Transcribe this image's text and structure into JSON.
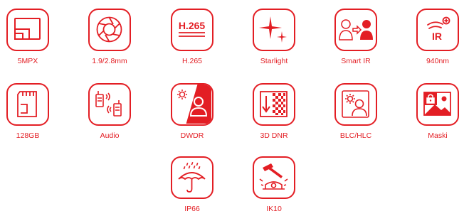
{
  "accent_color": "#e31e24",
  "features": [
    {
      "label": "5MPX",
      "icon": "resolution-screen-icon"
    },
    {
      "label": "1.9/2.8mm",
      "icon": "lens-aperture-icon"
    },
    {
      "label": "H.265",
      "icon": "h265-codec-icon",
      "icon_text": "H.265"
    },
    {
      "label": "Starlight",
      "icon": "starlight-icon"
    },
    {
      "label": "Smart IR",
      "icon": "smart-ir-icon"
    },
    {
      "label": "940nm",
      "icon": "ir-940nm-icon",
      "icon_text": "IR"
    },
    {
      "label": "128GB",
      "icon": "sd-card-icon"
    },
    {
      "label": "Audio",
      "icon": "audio-walkie-talkie-icon"
    },
    {
      "label": "DWDR",
      "icon": "dwdr-icon"
    },
    {
      "label": "3D DNR",
      "icon": "3d-dnr-icon"
    },
    {
      "label": "BLC/HLC",
      "icon": "blc-hlc-icon"
    },
    {
      "label": "Maski",
      "icon": "privacy-mask-icon"
    },
    {
      "label": "IP66",
      "icon": "umbrella-rain-icon"
    },
    {
      "label": "IK10",
      "icon": "vandal-hammer-icon"
    }
  ]
}
